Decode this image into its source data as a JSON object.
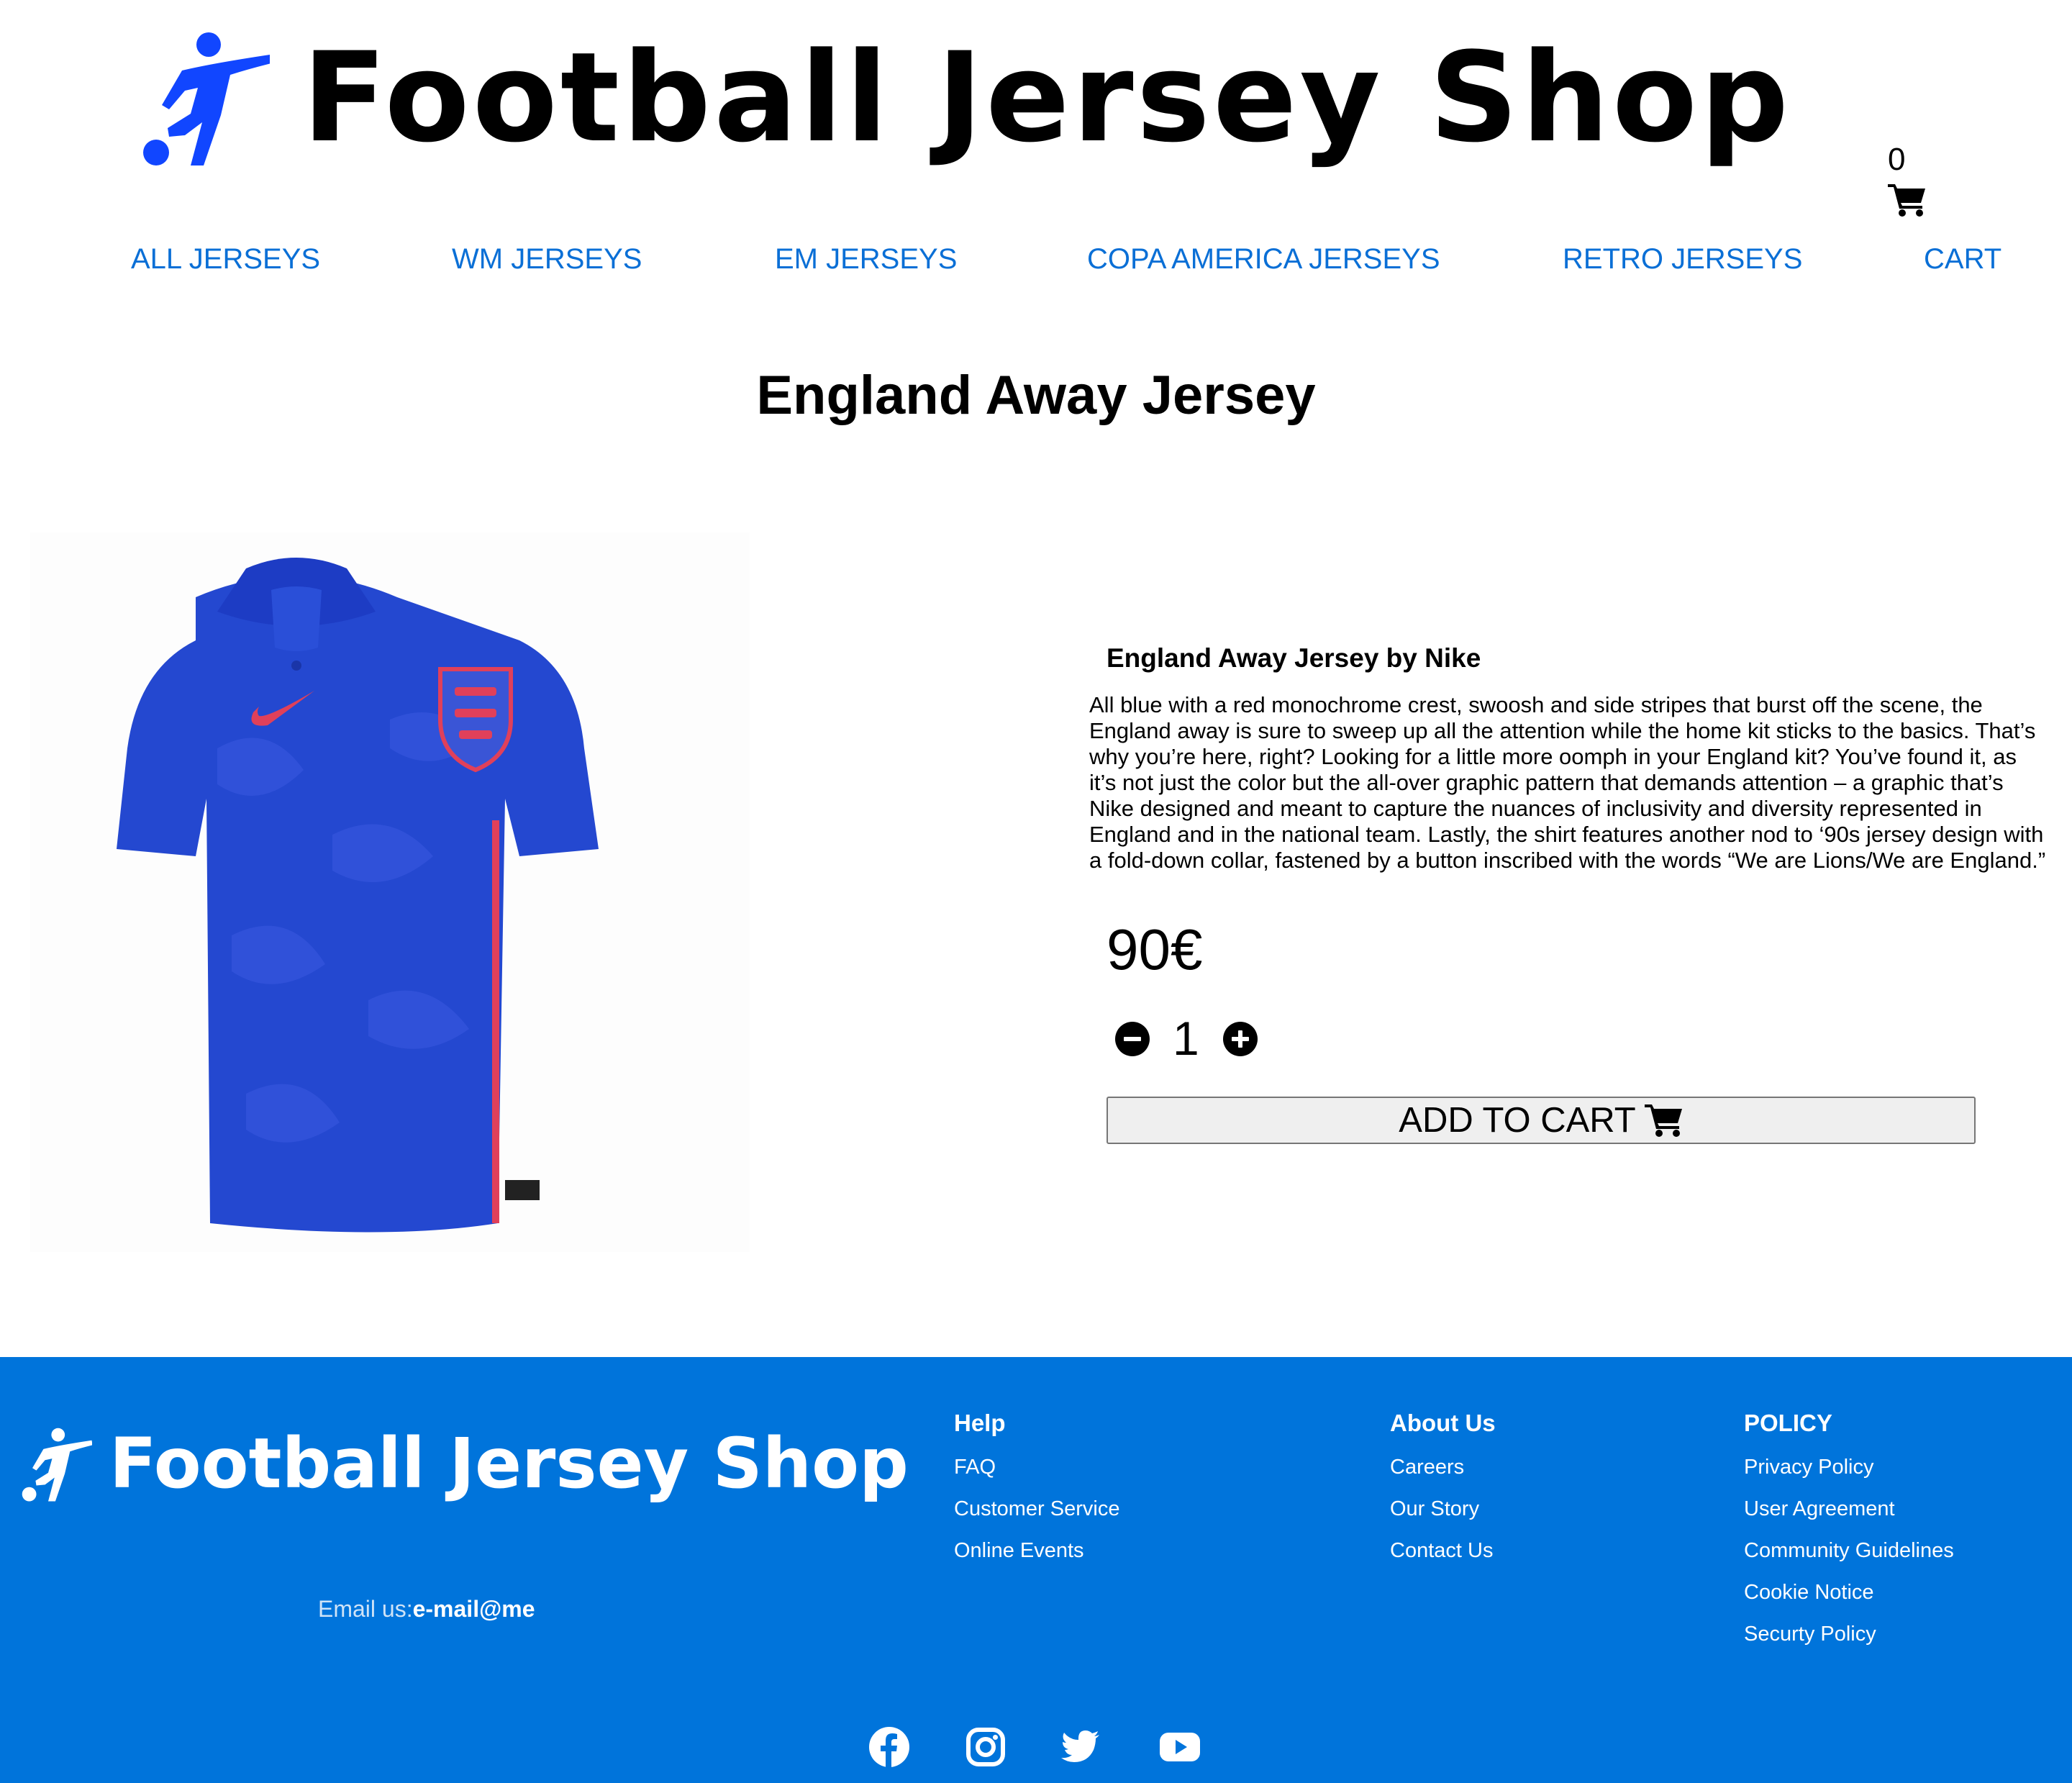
{
  "header": {
    "title": "Football Jersey Shop",
    "cart_count": "0",
    "cart_icon": "shopping-cart-icon",
    "logo_icon": "football-player-icon"
  },
  "nav": {
    "items": [
      {
        "label": "ALL JERSEYS"
      },
      {
        "label": "WM JERSEYS"
      },
      {
        "label": "EM JERSEYS"
      },
      {
        "label": "COPA AMERICA JERSEYS"
      },
      {
        "label": "RETRO JERSEYS"
      },
      {
        "label": "CART"
      }
    ]
  },
  "page": {
    "title": "England Away Jersey"
  },
  "product": {
    "image_icon": "england-away-jersey-image",
    "name": "England Away Jersey by Nike",
    "description": "All blue with a red monochrome crest, swoosh and side stripes that burst off the scene, the England away is sure to sweep up all the attention while the home kit sticks to the basics. That’s why you’re here, right? Looking for a little more oomph in your England kit? You’ve found it, as it’s not just the color but the all-over graphic pattern that demands attention – a graphic that’s Nike designed and meant to capture the nuances of inclusivity and diversity represented in England and in the national team. Lastly, the shirt features another nod to ‘90s jersey design with a fold-down collar, fastened by a button inscribed with the words “We are Lions/We are England.”",
    "price": "90€",
    "quantity": "1",
    "add_to_cart_label": "ADD TO CART",
    "minus_icon": "minus-circle-icon",
    "plus_icon": "plus-circle-icon"
  },
  "footer": {
    "title": "Football Jersey Shop",
    "email_label": "Email us:",
    "email_value": "e-mail@me",
    "columns": [
      {
        "heading": "Help",
        "links": [
          "FAQ",
          "Customer Service",
          "Online Events"
        ]
      },
      {
        "heading": "About Us",
        "links": [
          "Careers",
          "Our Story",
          "Contact Us"
        ]
      },
      {
        "heading": "POLICY",
        "links": [
          "Privacy Policy",
          "User Agreement",
          "Community Guidelines",
          "Cookie Notice",
          "Securty Policy"
        ]
      }
    ],
    "social_icons": [
      "facebook-icon",
      "instagram-icon",
      "twitter-icon",
      "youtube-icon"
    ]
  },
  "colors": {
    "accent": "#0a6fd6",
    "footer_bg": "#0074db",
    "logo_blue": "#1146ff",
    "jersey_blue": "#2448d0"
  }
}
